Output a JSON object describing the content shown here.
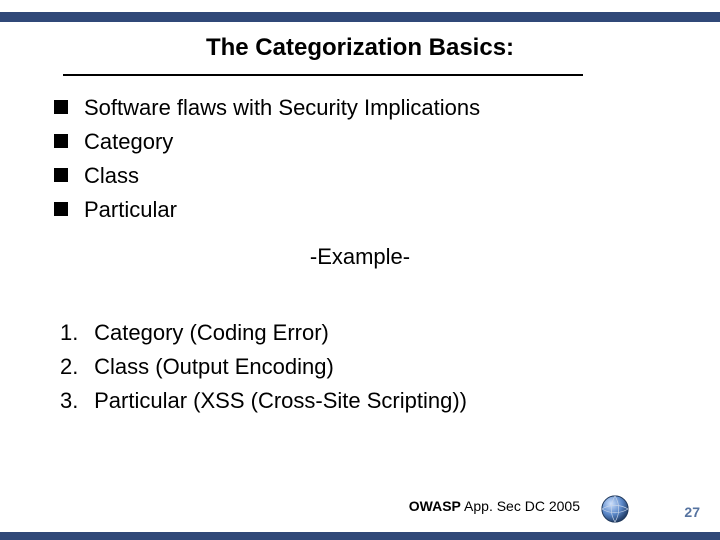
{
  "title": "The Categorization Basics:",
  "bullets": [
    "Software flaws with Security Implications",
    "Category",
    "Class",
    "Particular"
  ],
  "exampleLabel": "-Example-",
  "numbered": [
    "Category (Coding Error)",
    "Class (Output Encoding)",
    "Particular (XSS (Cross-Site Scripting))"
  ],
  "footer": {
    "org": "OWASP",
    "event": "App. Sec DC 2005"
  },
  "pageNumber": "27",
  "colors": {
    "brandBlue": "#304878"
  }
}
